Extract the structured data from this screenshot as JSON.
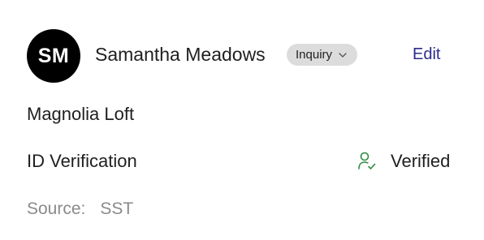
{
  "contact": {
    "initials": "SM",
    "name": "Samantha Meadows",
    "status": "Inquiry",
    "edit_label": "Edit"
  },
  "property": {
    "name": "Magnolia Loft"
  },
  "verification": {
    "label": "ID Verification",
    "status": "Verified",
    "icon": "user-check-icon",
    "icon_color": "#2e8b3e"
  },
  "source": {
    "label": "Source:",
    "value": "SST"
  },
  "colors": {
    "avatar_bg": "#000000",
    "pill_bg": "#dcdcdc",
    "link": "#2b2b8f",
    "muted": "#8a8a8a"
  }
}
